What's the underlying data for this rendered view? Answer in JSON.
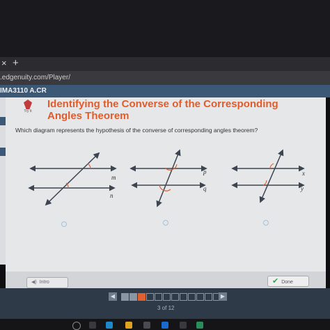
{
  "browser": {
    "tab_close_glyph": "×",
    "new_tab_glyph": "+",
    "url": ".edgenuity.com/Player/"
  },
  "course": {
    "code": "IMA3110 A.CR"
  },
  "activity": {
    "badge_label": "Try It",
    "title": "Identifying the Converse of the Corresponding Angles Theorem",
    "question": "Which diagram represents the hypothesis of the converse of corresponding angles theorem?"
  },
  "diagrams": [
    {
      "line1_label": "m",
      "line2_label": "n"
    },
    {
      "line1_label": "p",
      "line2_label": "q"
    },
    {
      "line1_label": "x",
      "line2_label": "y"
    }
  ],
  "footer": {
    "intro_label": "Intro",
    "done_label": "Done",
    "pager_text": "3 of 12",
    "prev_glyph": "◀",
    "next_glyph": "▶"
  },
  "colors": {
    "title": "#e25c2b",
    "angle_mark": "#e0602f",
    "line": "#3d4650",
    "course_bar": "#3b5877"
  }
}
